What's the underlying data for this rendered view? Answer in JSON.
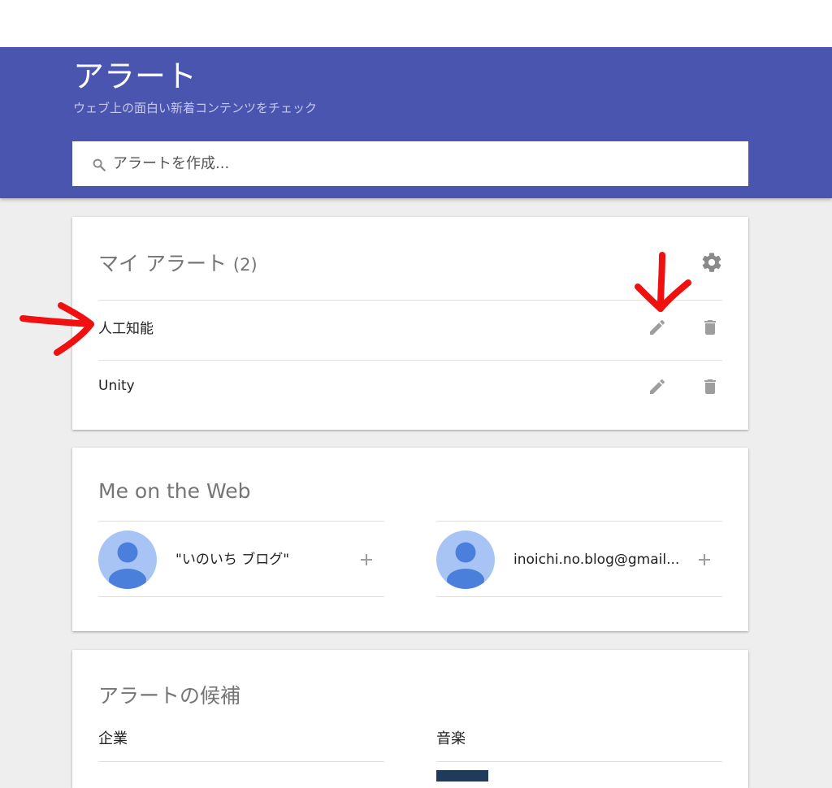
{
  "header": {
    "title": "アラート",
    "subtitle": "ウェブ上の面白い新着コンテンツをチェック",
    "search_placeholder": "アラートを作成..."
  },
  "my_alerts": {
    "title": "マイ アラート",
    "count": "(2)",
    "items": [
      {
        "label": "人工知能"
      },
      {
        "label": "Unity"
      }
    ]
  },
  "me_on_web": {
    "title": "Me on the Web",
    "items": [
      {
        "label": "\"いのいち ブログ\""
      },
      {
        "label": "inoichi.no.blog@gmail..."
      }
    ]
  },
  "suggestions": {
    "title": "アラートの候補",
    "categories": [
      {
        "label": "企業"
      },
      {
        "label": "音楽"
      }
    ]
  },
  "colors": {
    "header_bg": "#4a55b0",
    "annotation_arrow": "#f01010",
    "icon_gray": "#9e9e9e",
    "avatar_bg": "#a8c4f4",
    "avatar_fg": "#4a7fdc"
  }
}
